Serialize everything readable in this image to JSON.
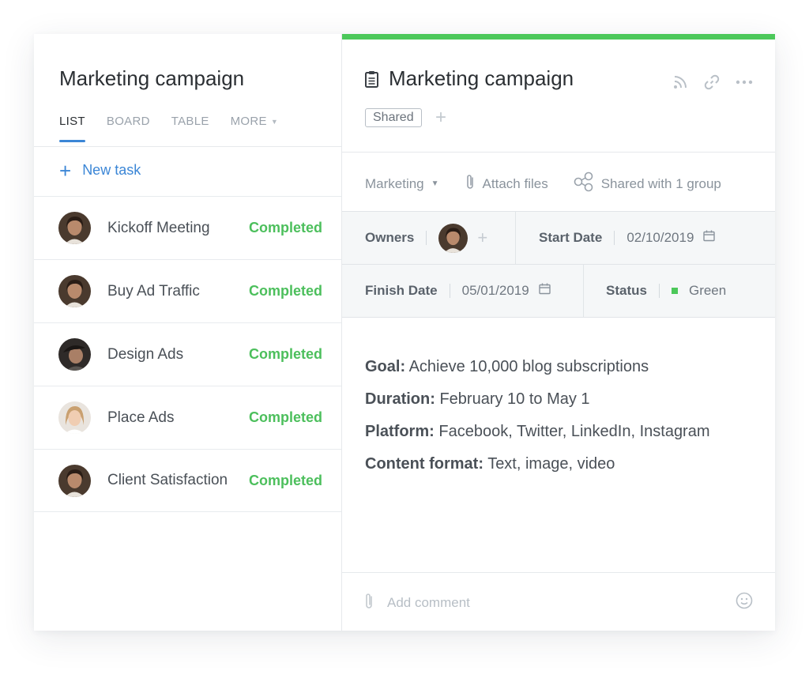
{
  "left": {
    "title": "Marketing campaign",
    "tabs": [
      {
        "label": "LIST"
      },
      {
        "label": "BOARD"
      },
      {
        "label": "TABLE"
      },
      {
        "label": "MORE"
      }
    ],
    "new_task": "New task",
    "tasks": [
      {
        "name": "Kickoff Meeting",
        "status": "Completed"
      },
      {
        "name": "Buy Ad Traffic",
        "status": "Completed"
      },
      {
        "name": "Design Ads",
        "status": "Completed"
      },
      {
        "name": "Place Ads",
        "status": "Completed"
      },
      {
        "name": "Client Satisfaction",
        "status": "Completed"
      }
    ]
  },
  "right": {
    "title": "Marketing campaign",
    "tag": "Shared",
    "meta": {
      "folder": "Marketing",
      "attach": "Attach files",
      "shared": "Shared with 1 group"
    },
    "fields": {
      "owners_label": "Owners",
      "start_label": "Start Date",
      "start_value": "02/10/2019",
      "finish_label": "Finish Date",
      "finish_value": "05/01/2019",
      "status_label": "Status",
      "status_value": "Green"
    },
    "description": [
      {
        "label": "Goal:",
        "text": "Achieve 10,000 blog subscriptions"
      },
      {
        "label": "Duration:",
        "text": "February 10 to May 1"
      },
      {
        "label": "Platform:",
        "text": "Facebook, Twitter, LinkedIn, Instagram"
      },
      {
        "label": "Content format:",
        "text": "Text, image, video"
      }
    ],
    "comment_placeholder": "Add comment"
  },
  "colors": {
    "accent": "#3b86d6",
    "completed": "#4cbf5c",
    "top_bar": "#4cc85a"
  }
}
